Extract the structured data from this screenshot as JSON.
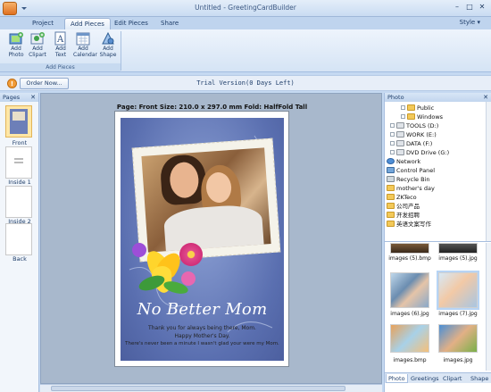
{
  "window": {
    "title": "Untitled - GreetingCardBuilder"
  },
  "tabs": [
    "Project",
    "Add Pieces",
    "Edit Pieces",
    "Share"
  ],
  "style_menu": "Style",
  "ribbon": {
    "buttons": [
      {
        "label1": "Add",
        "label2": "Photo",
        "icon": "add-photo-icon"
      },
      {
        "label1": "Add",
        "label2": "Clipart",
        "icon": "add-clipart-icon"
      },
      {
        "label1": "Add",
        "label2": "Text",
        "icon": "add-text-icon"
      },
      {
        "label1": "Add",
        "label2": "Calendar",
        "icon": "add-calendar-icon"
      },
      {
        "label1": "Add",
        "label2": "Shape",
        "icon": "add-shape-icon"
      }
    ],
    "group_label": "Add Pieces"
  },
  "trial": {
    "order_button": "Order Now...",
    "message": "Trial Version(0 Days Left)"
  },
  "pages_panel": {
    "title": "Pages",
    "pages": [
      "Front",
      "Inside 1",
      "Inside 2",
      "Back"
    ]
  },
  "canvas": {
    "page_info": "Page: Front   Size: 210.0 x 297.0 mm   Fold: HalfFold Tall",
    "card_title": "No Better Mom",
    "card_lines": [
      "Thank you for always being there, Mom.",
      "Happy Mother's Day.",
      "There's never been a minute I wasn't glad your were my Mom."
    ]
  },
  "photo_panel": {
    "title": "Photo",
    "tree": [
      {
        "label": "Public",
        "icon": "folder",
        "indent": 3
      },
      {
        "label": "Windows",
        "icon": "folder",
        "indent": 3
      },
      {
        "label": "TOOLS (D:)",
        "icon": "drive",
        "indent": 1
      },
      {
        "label": "WORK (E:)",
        "icon": "drive",
        "indent": 1
      },
      {
        "label": "DATA (F:)",
        "icon": "drive",
        "indent": 1
      },
      {
        "label": "DVD Drive (G:)",
        "icon": "drive",
        "indent": 1
      },
      {
        "label": "Network",
        "icon": "net",
        "indent": 0
      },
      {
        "label": "Control Panel",
        "icon": "cpanel",
        "indent": 0
      },
      {
        "label": "Recycle Bin",
        "icon": "bin",
        "indent": 0
      },
      {
        "label": "mother's day",
        "icon": "folder",
        "indent": 0
      },
      {
        "label": "ZKTeco",
        "icon": "folder",
        "indent": 0
      },
      {
        "label": "公司产品",
        "icon": "folder",
        "indent": 0
      },
      {
        "label": "开发招聘",
        "icon": "folder",
        "indent": 0
      },
      {
        "label": "英语文案写作",
        "icon": "folder",
        "indent": 0
      }
    ],
    "gallery": [
      "images (5).bmp",
      "images (5).jpg",
      "images (6).jpg",
      "images (7).jpg",
      "images.bmp",
      "images.jpg"
    ],
    "tabs": [
      "Photo",
      "Greetings",
      "Clipart",
      "Shape"
    ]
  }
}
